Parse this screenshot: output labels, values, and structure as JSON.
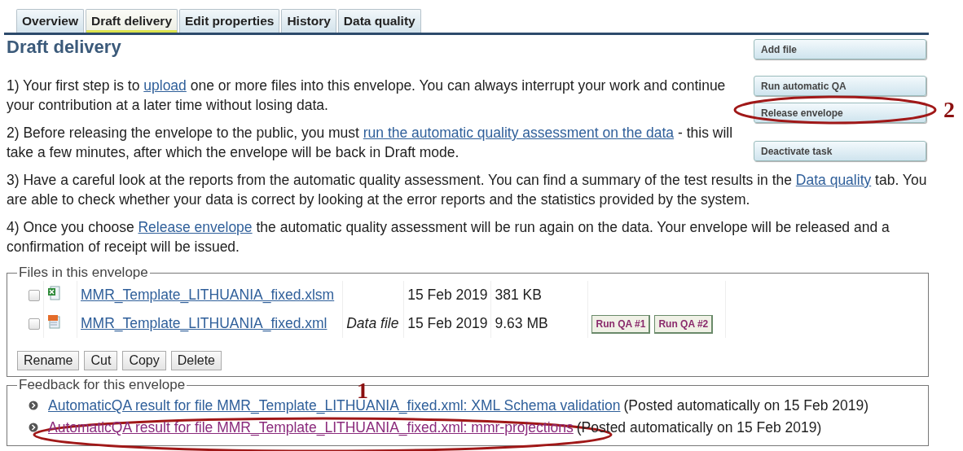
{
  "tabs": [
    {
      "label": "Overview",
      "selected": false
    },
    {
      "label": "Draft delivery",
      "selected": true
    },
    {
      "label": "Edit properties",
      "selected": false
    },
    {
      "label": "History",
      "selected": false
    },
    {
      "label": "Data quality",
      "selected": false
    }
  ],
  "heading": "Draft delivery",
  "actions": [
    "Add file",
    "Run automatic QA",
    "Release envelope",
    "Deactivate task"
  ],
  "steps": [
    [
      {
        "text": "1) Your first step is to "
      },
      {
        "link": "upload"
      },
      {
        "text": " one or more files into this envelope. You can always interrupt your work and continue your contribution at a later time without losing data."
      }
    ],
    [
      {
        "text": "2) Before releasing the envelope to the public, you must "
      },
      {
        "link": "run the automatic quality assessment on the data"
      },
      {
        "text": " - this will take a few minutes, after which the envelope will be back in Draft mode."
      }
    ],
    [
      {
        "text": "3) Have a careful look at the reports from the automatic quality assessment. You can find a summary of the test results in the "
      },
      {
        "link": "Data quality"
      },
      {
        "text": " tab. You are able to check whether your data is correct by looking at the error reports and the statistics provided by the system."
      }
    ],
    [
      {
        "text": "4) Once you choose "
      },
      {
        "link": "Release envelope"
      },
      {
        "text": " the automatic quality assessment will be run again on the data. Your envelope will be released and a confirmation of receipt will be issued."
      }
    ]
  ],
  "files": {
    "legend": "Files in this envelope",
    "rows": [
      {
        "checked": false,
        "kind": "spreadsheet",
        "name": "MMR_Template_LITHUANIA_fixed.xlsm",
        "date": "15 Feb 2019",
        "size": "381 KB"
      },
      {
        "checked": false,
        "kind": "xml",
        "name": "MMR_Template_LITHUANIA_fixed.xml",
        "type": "Data file",
        "date": "15 Feb 2019",
        "size": "9.63 MB",
        "qa_buttons": [
          "Run QA #1",
          "Run QA #2"
        ]
      }
    ],
    "buttons": [
      "Rename",
      "Cut",
      "Copy",
      "Delete"
    ]
  },
  "feedback": {
    "legend": "Feedback for this envelope",
    "items": [
      {
        "link": "AutomaticQA result for file MMR_Template_LITHUANIA_fixed.xml: XML Schema validation",
        "visited": false,
        "note": "(Posted automatically on 15 Feb 2019)"
      },
      {
        "link": "AutomaticQA result for file MMR_Template_LITHUANIA_fixed.xml: mmr-projections",
        "visited": true,
        "note": "(Posted automatically on 15 Feb 2019)"
      }
    ]
  },
  "annotations": [
    {
      "label": "2"
    },
    {
      "label": "1"
    }
  ]
}
